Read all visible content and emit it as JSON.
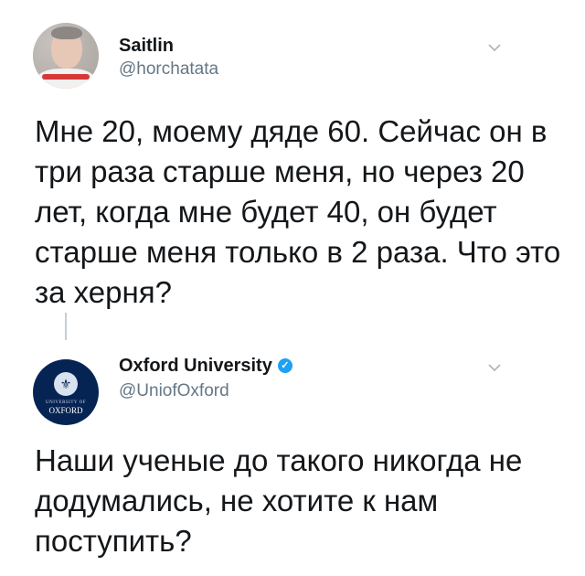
{
  "tweets": [
    {
      "name": "Saitlin",
      "handle": "@horchatata",
      "text": "Мне 20, моему дяде 60. Сейчас он в три раза старше меня, но через 20 лет, когда мне будет 40, он будет старше меня только в 2 раза. Что это за херня?"
    },
    {
      "name": "Oxford University",
      "handle": "@UniofOxford",
      "verified": true,
      "avatar_text_small": "UNIVERSITY OF",
      "avatar_text_big": "OXFORD",
      "text": "Наши ученые до такого никогда не додумались, не хотите к нам поступить?"
    }
  ],
  "icons": {
    "menu": "chevron-down-icon",
    "verified": "verified-badge-icon"
  },
  "colors": {
    "text": "#14171a",
    "muted": "#657786",
    "verified": "#1da1f2",
    "oxford_blue": "#062453"
  }
}
